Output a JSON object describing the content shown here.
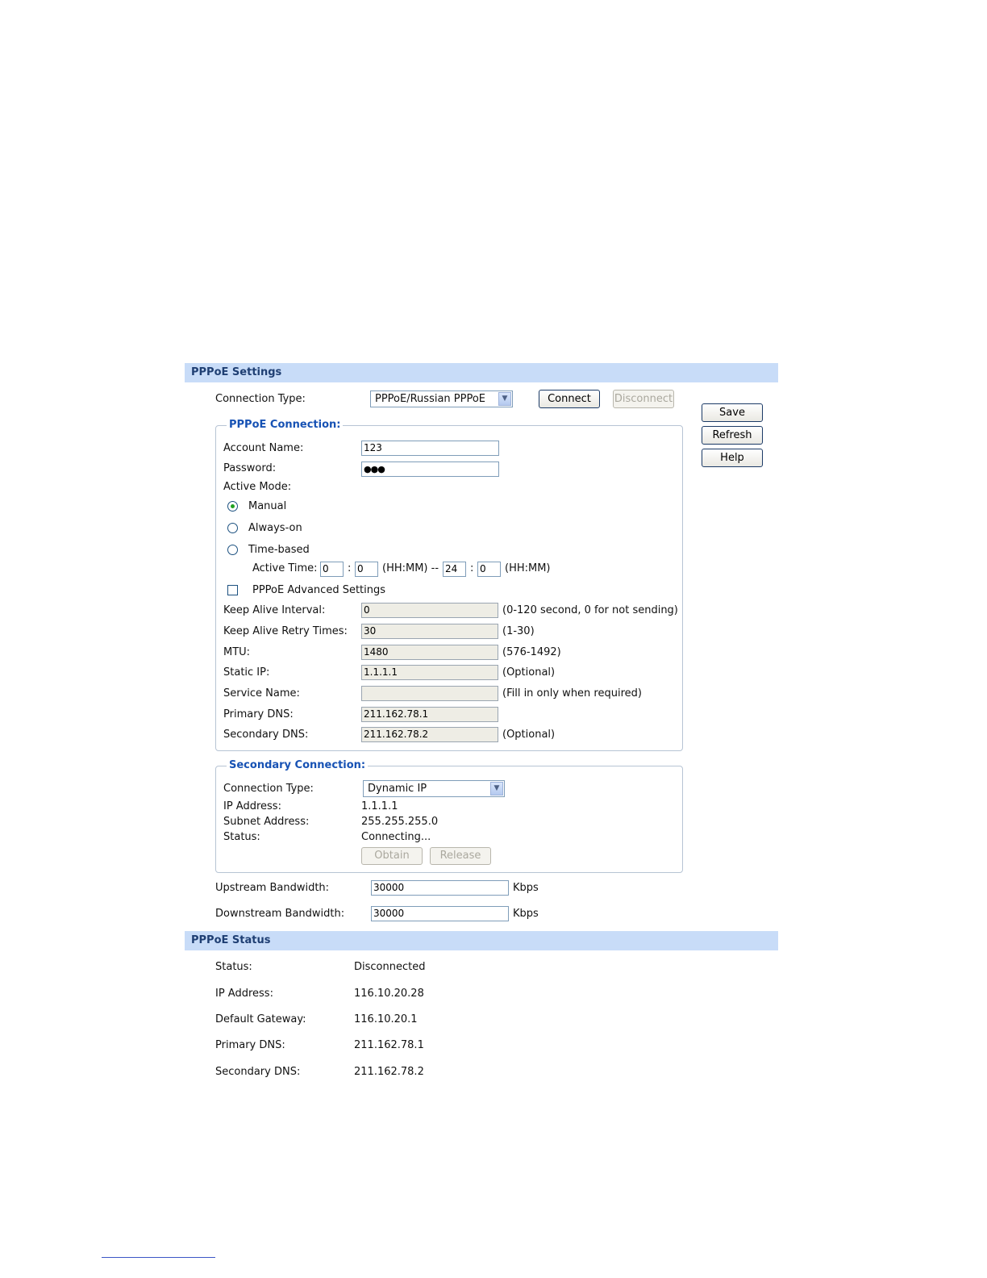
{
  "pppoe_settings": {
    "header": "PPPoE Settings",
    "connection_type_label": "Connection Type:",
    "connection_type_value": "PPPoE/Russian PPPoE",
    "connect_label": "Connect",
    "disconnect_label": "Disconnect"
  },
  "side_buttons": {
    "save": "Save",
    "refresh": "Refresh",
    "help": "Help"
  },
  "pppoe_connection": {
    "legend": "PPPoE Connection:",
    "account_name_label": "Account Name:",
    "account_name_value": "123",
    "password_label": "Password:",
    "password_value": "●●●",
    "active_mode_label": "Active Mode:",
    "modes": [
      {
        "label": "Manual",
        "selected": true
      },
      {
        "label": "Always-on",
        "selected": false
      },
      {
        "label": "Time-based",
        "selected": false
      }
    ],
    "active_time": {
      "label": "Active Time:",
      "start_hh": "0",
      "start_mm": "0",
      "colon": ":",
      "separator": "(HH:MM) --",
      "end_hh": "24",
      "end_mm": "0",
      "suffix": "(HH:MM)"
    },
    "advanced_label": "PPPoE Advanced Settings",
    "advanced_checked": false,
    "fields": [
      {
        "label": "Keep Alive Interval:",
        "value": "0",
        "hint": "(0-120 second, 0 for not sending)"
      },
      {
        "label": "Keep Alive Retry Times:",
        "value": "30",
        "hint": "(1-30)"
      },
      {
        "label": "MTU:",
        "value": "1480",
        "hint": "(576-1492)"
      },
      {
        "label": "Static IP:",
        "value": "1.1.1.1",
        "hint": "(Optional)"
      },
      {
        "label": "Service Name:",
        "value": "",
        "hint": "(Fill in only when required)"
      },
      {
        "label": "Primary DNS:",
        "value": "211.162.78.1",
        "hint": ""
      },
      {
        "label": "Secondary DNS:",
        "value": "211.162.78.2",
        "hint": "(Optional)"
      }
    ]
  },
  "secondary_connection": {
    "legend": "Secondary Connection:",
    "connection_type_label": "Connection Type:",
    "connection_type_value": "Dynamic IP",
    "ip_label": "IP Address:",
    "ip_value": "1.1.1.1",
    "subnet_label": "Subnet Address:",
    "subnet_value": "255.255.255.0",
    "status_label": "Status:",
    "status_value": "Connecting...",
    "obtain_label": "Obtain",
    "release_label": "Release"
  },
  "bandwidth": {
    "upstream_label": "Upstream Bandwidth:",
    "upstream_value": "30000",
    "downstream_label": "Downstream Bandwidth:",
    "downstream_value": "30000",
    "unit": "Kbps"
  },
  "pppoe_status": {
    "header": "PPPoE Status",
    "rows": [
      {
        "label": "Status:",
        "value": "Disconnected"
      },
      {
        "label": "IP Address:",
        "value": "116.10.20.28"
      },
      {
        "label": "Default Gateway:",
        "value": "116.10.20.1"
      },
      {
        "label": "Primary DNS:",
        "value": "211.162.78.1"
      },
      {
        "label": "Secondary DNS:",
        "value": "211.162.78.2"
      }
    ]
  },
  "colors": {
    "header_bg": "#c8dcf8",
    "header_text": "#1f3f73",
    "legend_text": "#1752b4",
    "radio_dot": "#21a121"
  }
}
